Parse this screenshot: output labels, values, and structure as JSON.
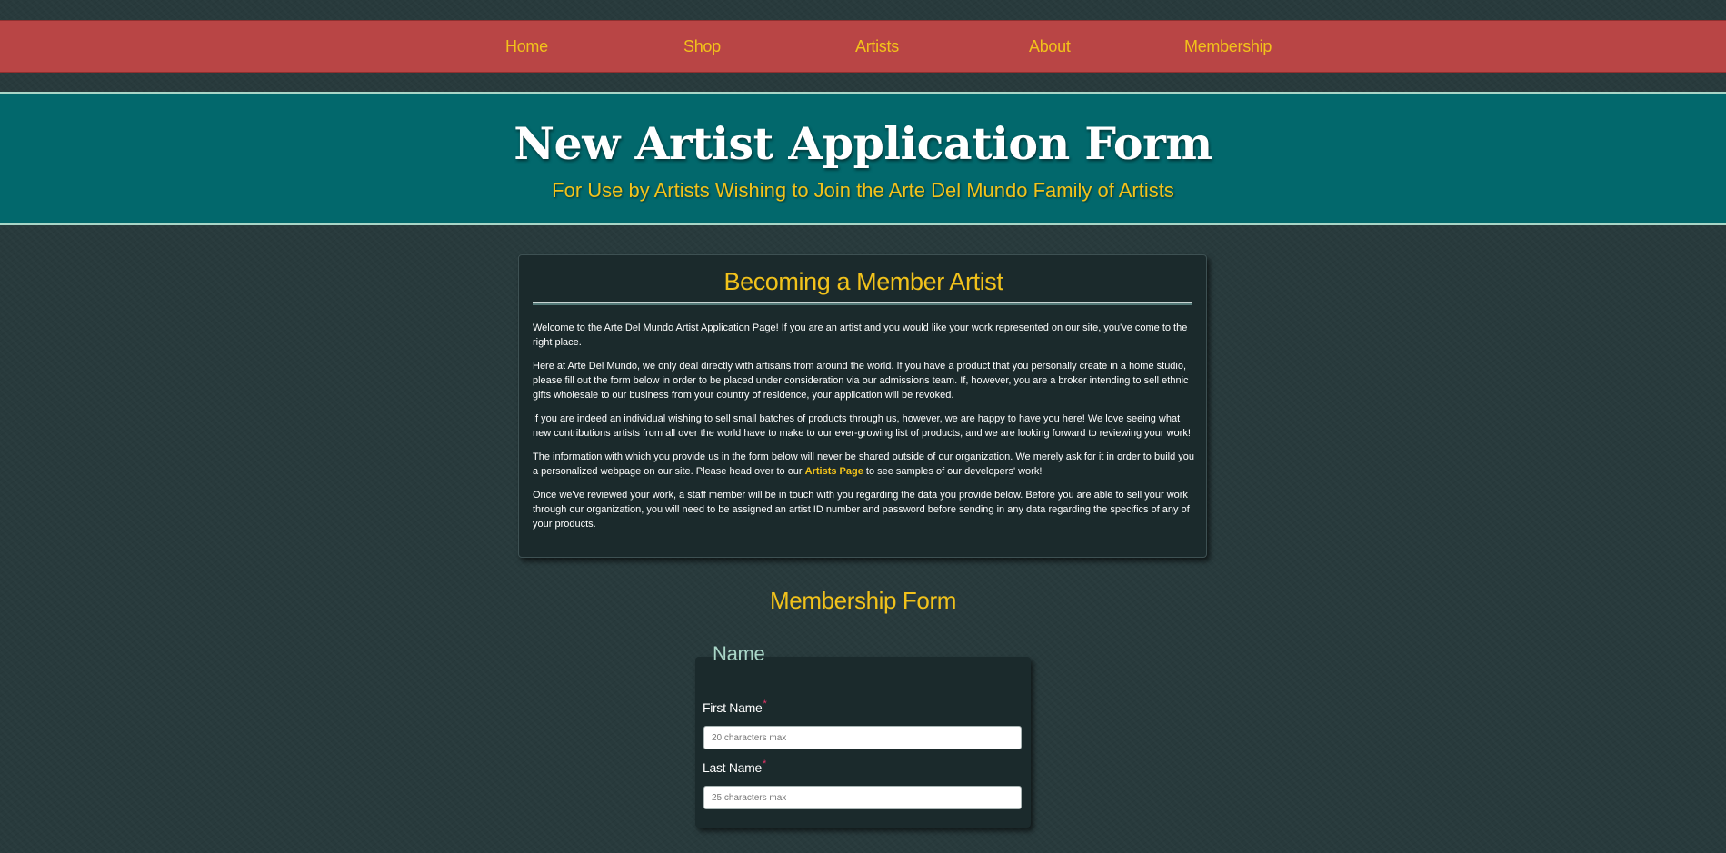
{
  "nav": {
    "items": [
      {
        "label": "Home"
      },
      {
        "label": "Shop"
      },
      {
        "label": "Artists"
      },
      {
        "label": "About"
      },
      {
        "label": "Membership"
      }
    ]
  },
  "banner": {
    "title": "New Artist Application Form",
    "subtitle": "For Use by Artists Wishing to Join the Arte Del Mundo Family of Artists"
  },
  "intro": {
    "heading": "Becoming a Member Artist",
    "p1": "Welcome to the Arte Del Mundo Artist Application Page! If you are an artist and you would like your work represented on our site, you've come to the right place.",
    "p2": "Here at Arte Del Mundo, we only deal directly with artisans from around the world. If you have a product that you personally create in a home studio, please fill out the form below in order to be placed under consideration via our admissions team. If, however, you are a broker intending to sell ethnic gifts wholesale to our business from your country of residence, your application will be revoked.",
    "p3": "If you are indeed an individual wishing to sell small batches of products through us, however, we are happy to have you here! We love seeing what new contributions artists from all over the world have to make to our ever-growing list of products, and we are looking forward to reviewing your work!",
    "p4_before": "The information with which you provide us in the form below will never be shared outside of our organization. We merely ask for it in order to build you a personalized webpage on our site. Please head over to our ",
    "p4_link": "Artists Page",
    "p4_after": " to see samples of our developers' work!",
    "p5": "Once we've reviewed your work, a staff member will be in touch with you regarding the data you provide below. Before you are able to sell your work through our organization, you will need to be assigned an artist ID number and password before sending in any data regarding the specifics of any of your products."
  },
  "form": {
    "title": "Membership Form",
    "legend": "Name",
    "required_marker": "*",
    "first_name": {
      "label": "First Name",
      "placeholder": "20 characters max",
      "value": ""
    },
    "last_name": {
      "label": "Last Name",
      "placeholder": "25 characters max",
      "value": ""
    }
  },
  "colors": {
    "nav_bg": "#b94545",
    "accent_gold": "#f2c21b",
    "banner_teal": "#02686c",
    "panel_bg": "#1b2a2c",
    "legend_mint": "#a9d6c7",
    "required_pink": "#e53568"
  }
}
